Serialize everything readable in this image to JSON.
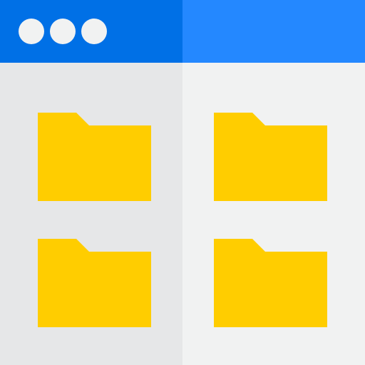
{
  "colors": {
    "titlebar_left": "#0070E6",
    "titlebar_right": "#2488FF",
    "window_dot": "#F1F2F2",
    "pane_left": "#E6E7E8",
    "pane_right": "#F1F2F2",
    "folder": "#FFCD00"
  },
  "titlebar": {
    "window_controls": [
      "circle-dot-icon",
      "circle-dot-icon",
      "circle-dot-icon"
    ]
  },
  "folders": [
    {
      "icon": "folder-icon"
    },
    {
      "icon": "folder-icon"
    },
    {
      "icon": "folder-icon"
    },
    {
      "icon": "folder-icon"
    }
  ]
}
